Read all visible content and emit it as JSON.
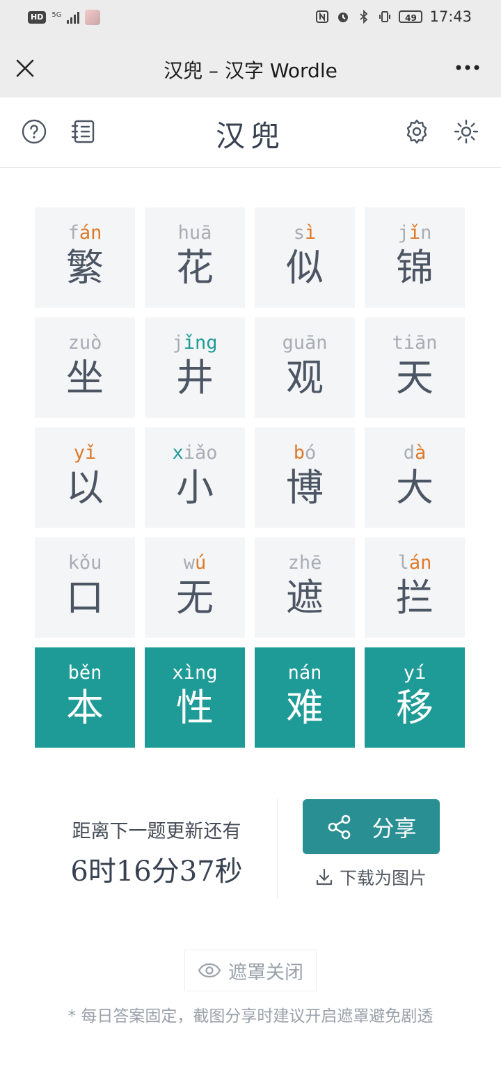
{
  "status_bar": {
    "hd": "HD",
    "network": "5G",
    "battery": "49",
    "time": "17:43"
  },
  "titlebar": {
    "title": "汉兜 – 汉字 Wordle"
  },
  "header": {
    "title": "汉兜"
  },
  "grid": {
    "rows": [
      [
        {
          "chars": "繁",
          "pinyin": [
            {
              "t": "f",
              "c": ""
            },
            {
              "t": "án",
              "c": "o"
            }
          ]
        },
        {
          "chars": "花",
          "pinyin": [
            {
              "t": "huā",
              "c": ""
            }
          ]
        },
        {
          "chars": "似",
          "pinyin": [
            {
              "t": "s",
              "c": ""
            },
            {
              "t": "ì",
              "c": "o"
            }
          ]
        },
        {
          "chars": "锦",
          "pinyin": [
            {
              "t": "j",
              "c": ""
            },
            {
              "t": "ǐ",
              "c": "o"
            },
            {
              "t": "n",
              "c": ""
            }
          ]
        }
      ],
      [
        {
          "chars": "坐",
          "pinyin": [
            {
              "t": "zu",
              "c": ""
            },
            {
              "t": "ò",
              "c": ""
            }
          ]
        },
        {
          "chars": "井",
          "pinyin": [
            {
              "t": "j",
              "c": ""
            },
            {
              "t": "ǐng",
              "c": "t"
            }
          ]
        },
        {
          "chars": "观",
          "pinyin": [
            {
              "t": "guān",
              "c": ""
            }
          ]
        },
        {
          "chars": "天",
          "pinyin": [
            {
              "t": "tiān",
              "c": ""
            }
          ]
        }
      ],
      [
        {
          "chars": "以",
          "pinyin": [
            {
              "t": "yǐ",
              "c": "o"
            }
          ]
        },
        {
          "chars": "小",
          "pinyin": [
            {
              "t": "x",
              "c": "t"
            },
            {
              "t": "iǎo",
              "c": ""
            }
          ]
        },
        {
          "chars": "博",
          "pinyin": [
            {
              "t": "b",
              "c": "o"
            },
            {
              "t": "ó",
              "c": ""
            }
          ]
        },
        {
          "chars": "大",
          "pinyin": [
            {
              "t": "d",
              "c": ""
            },
            {
              "t": "à",
              "c": "o"
            }
          ]
        }
      ],
      [
        {
          "chars": "口",
          "pinyin": [
            {
              "t": "kǒu",
              "c": ""
            }
          ]
        },
        {
          "chars": "无",
          "pinyin": [
            {
              "t": "w",
              "c": ""
            },
            {
              "t": "ú",
              "c": "o"
            }
          ]
        },
        {
          "chars": "遮",
          "pinyin": [
            {
              "t": "zhē",
              "c": ""
            }
          ]
        },
        {
          "chars": "拦",
          "pinyin": [
            {
              "t": "l",
              "c": ""
            },
            {
              "t": "án",
              "c": "o"
            }
          ]
        }
      ],
      [
        {
          "chars": "本",
          "pinyin": [
            {
              "t": "běn",
              "c": ""
            }
          ],
          "correct": true
        },
        {
          "chars": "性",
          "pinyin": [
            {
              "t": "xìng",
              "c": ""
            }
          ],
          "correct": true
        },
        {
          "chars": "难",
          "pinyin": [
            {
              "t": "nán",
              "c": ""
            }
          ],
          "correct": true
        },
        {
          "chars": "移",
          "pinyin": [
            {
              "t": "yí",
              "c": ""
            }
          ],
          "correct": true
        }
      ]
    ]
  },
  "countdown": {
    "label": "距离下一题更新还有",
    "time": "6时16分37秒"
  },
  "share": {
    "label": "分享",
    "download_label": "下载为图片"
  },
  "mask": {
    "label": "遮罩关闭"
  },
  "note": "* 每日答案固定，截图分享时建议开启遮罩避免剧透",
  "colors": {
    "correct": "#1f9b97",
    "present": "#dd7a2a",
    "absent": "#a8adb5",
    "tile_bg": "#f4f5f7"
  }
}
